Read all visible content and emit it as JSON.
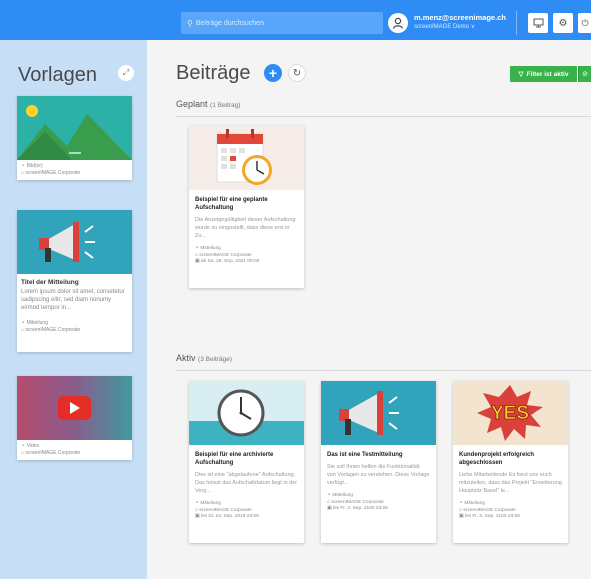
{
  "header": {
    "search_placeholder": "Beiträge durchsuchen",
    "user_email": "m.menz@screenimage.ch",
    "user_org": "screenIMAGE Demo ∨"
  },
  "sidebar": {
    "title": "Vorlagen",
    "templates": [
      {
        "type": "Bild(er)",
        "org": "screenIMAGE Corporate"
      },
      {
        "title": "Titel der Mitteilung",
        "text": "Lorem ipsum dolor sit amet, consetetur sadipscing elitr, sed diam nonumy eirmod tempor in...",
        "type": "Mitteilung",
        "org": "screenIMAGE Corporate"
      },
      {
        "type": "Video",
        "org": "screenIMAGE Corporate"
      }
    ]
  },
  "main": {
    "title": "Beiträge",
    "filter_label": "Filter ist aktiv",
    "sections": {
      "planned": {
        "label": "Geplant",
        "count": "(1 Beitrag)"
      },
      "active": {
        "label": "Aktiv",
        "count": "(3 Beiträge)"
      }
    },
    "planned_posts": [
      {
        "title": "Beispiel für eine geplante Aufschaltung",
        "text": "Die Anzeigegültigkeit dieser Aufschaltung wurde so eingestellt, dass diese erst in Zu...",
        "type": "Mitteilung",
        "org": "screenIMAGE Corporate",
        "date": "ab Sa. 25. Sep. 2021 00:00"
      }
    ],
    "active_posts": [
      {
        "title": "Beispiel für eine archivierte Aufschaltung",
        "text": "Dies ist eine \"abgelaufene\" Aufschaltung. Das heisst das Aufschaltdatum liegt in der Verg...",
        "type": "Mitteilung",
        "org": "screenIMAGE Corporate",
        "date": "bis Di. 24. Sep. 2019 23:59"
      },
      {
        "title": "Das ist eine Testmitteilung",
        "text": "Sie soll Ihnen helfen die Funktionalität von Vorlagen zu verstehen. Diese Vorlage verfügt...",
        "type": "Mitteilung",
        "org": "screenIMAGE Corporate",
        "date": "bis Fr. 3. Sep. 2100 23:59"
      },
      {
        "title": "Kundenprojekt erfolgreich abgeschlossen",
        "text": "Liebe Mitarbeitende Es freut uns euch mitzuteilen, dass das Projekt \"Erweiterung Hauptsitz Basel\" le...",
        "type": "Mitteilung",
        "org": "screenIMAGE Corporate",
        "date": "bis Fr. 3. Sep. 2100 23:59"
      }
    ],
    "yes_label": "YES"
  },
  "colors": {
    "topbar": "#2f8cf5",
    "sidebar": "#c7dff6",
    "filter": "#37b34a"
  }
}
